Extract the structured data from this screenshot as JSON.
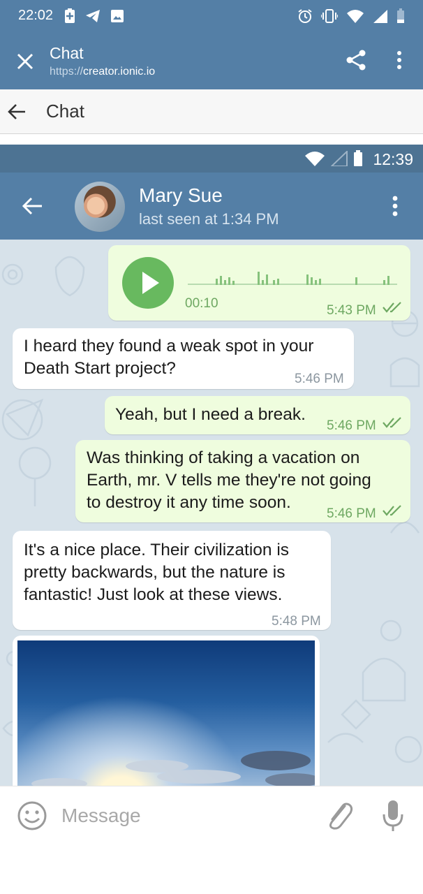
{
  "status_bar": {
    "time": "22:02"
  },
  "browser_tab": {
    "title": "Chat",
    "url_scheme": "https://",
    "url_host": "creator.ionic.io"
  },
  "app_toolbar": {
    "title": "Chat"
  },
  "phone": {
    "status_time": "12:39",
    "contact": {
      "name": "Mary Sue",
      "status": "last seen at 1:34 PM"
    },
    "messages": [
      {
        "type": "voice",
        "direction": "out",
        "duration": "00:10",
        "time": "5:43 PM",
        "read": true
      },
      {
        "type": "text",
        "direction": "in",
        "lines": [
          "I heard they found a weak spot in your",
          "Death Start project?"
        ],
        "time": "5:46 PM"
      },
      {
        "type": "text",
        "direction": "out",
        "lines": [
          "Yeah, but I need a break."
        ],
        "time": "5:46 PM",
        "read": true
      },
      {
        "type": "text",
        "direction": "out",
        "lines": [
          "Was thinking of taking a vacation on",
          "Earth, mr. V tells me they're not going",
          "to destroy it any time soon."
        ],
        "time": "5:46 PM",
        "read": true
      },
      {
        "type": "text",
        "direction": "in",
        "lines": [
          "It's a nice place. Their civilization is",
          "pretty backwards, but the nature is",
          "fantastic! Just look at these views."
        ],
        "time": "5:48 PM"
      },
      {
        "type": "photo",
        "direction": "in"
      }
    ],
    "input": {
      "placeholder": "Message"
    }
  },
  "colors": {
    "header_blue": "#547fa6",
    "outgoing_bubble": "#effdde",
    "incoming_bubble": "#ffffff",
    "check_green": "#6ea862",
    "play_green": "#68b95f"
  }
}
